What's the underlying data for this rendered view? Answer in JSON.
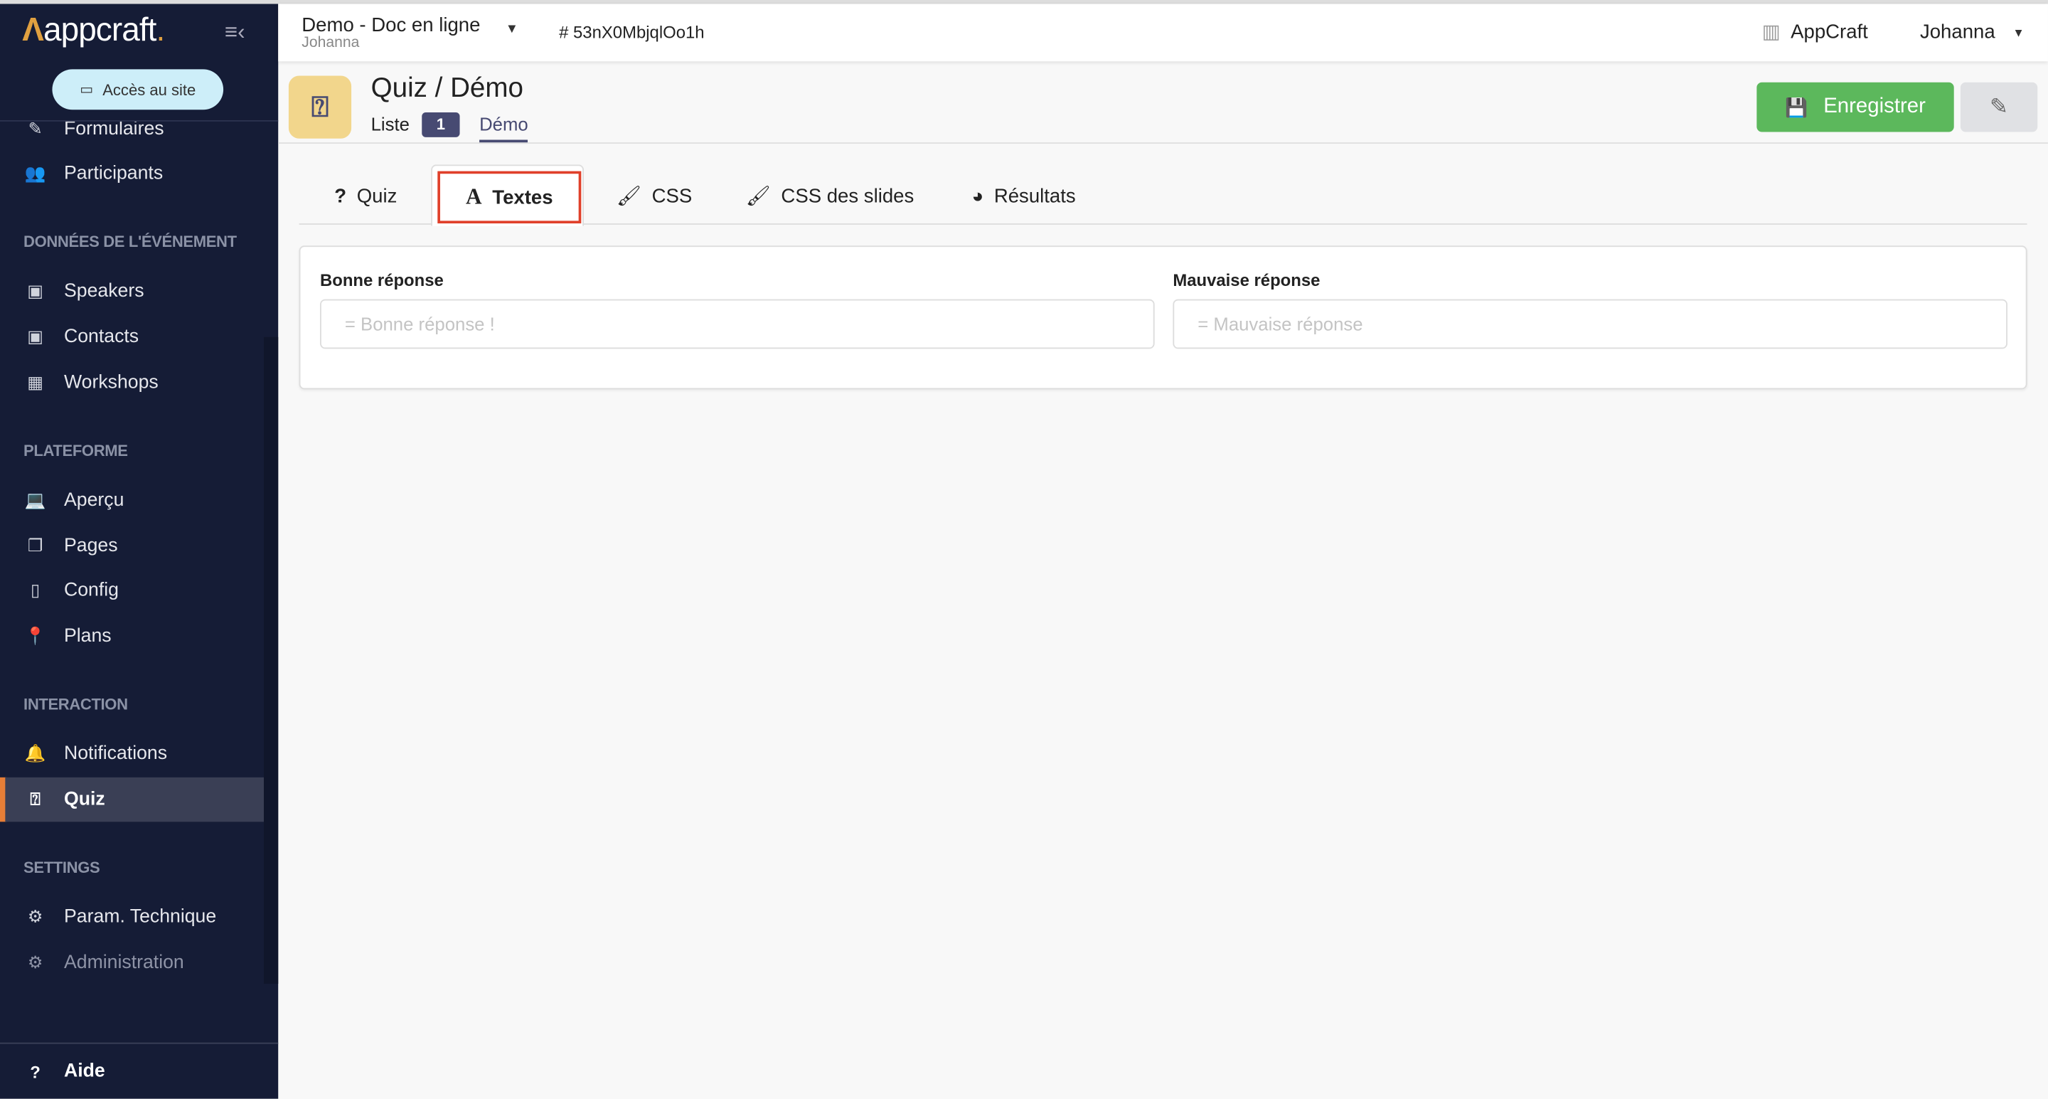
{
  "brand": {
    "logo_text": "appcraft",
    "colors": {
      "sidebar": "#151c36",
      "accent": "#e67e37",
      "save": "#5cb85c",
      "badge": "#474a72"
    }
  },
  "sidebar": {
    "site_button": "Accès au site",
    "partial_item": "Formulaires",
    "items_top": [
      {
        "label": "Participants",
        "icon": "users-icon"
      }
    ],
    "sections": [
      {
        "title": "DONNÉES DE L'ÉVÉNEMENT",
        "items": [
          {
            "label": "Speakers"
          },
          {
            "label": "Contacts"
          },
          {
            "label": "Workshops"
          }
        ]
      },
      {
        "title": "PLATEFORME",
        "items": [
          {
            "label": "Aperçu"
          },
          {
            "label": "Pages"
          },
          {
            "label": "Config"
          },
          {
            "label": "Plans"
          }
        ]
      },
      {
        "title": "INTERACTION",
        "items": [
          {
            "label": "Notifications"
          },
          {
            "label": "Quiz",
            "active": true
          }
        ]
      },
      {
        "title": "SETTINGS",
        "items": [
          {
            "label": "Param. Technique"
          },
          {
            "label": "Administration"
          }
        ]
      }
    ],
    "help": "Aide"
  },
  "header": {
    "project": "Demo - Doc en ligne",
    "owner": "Johanna",
    "id": "# 53nX0MbjqlOo1h",
    "org": "AppCraft",
    "user": "Johanna"
  },
  "page": {
    "title": "Quiz / Démo",
    "breadcrumb_list": "Liste",
    "list_count": "1",
    "breadcrumb_current": "Démo",
    "save_label": "Enregistrer"
  },
  "tabs": [
    {
      "label": "Quiz"
    },
    {
      "label": "Textes",
      "active": true
    },
    {
      "label": "CSS"
    },
    {
      "label": "CSS des slides"
    },
    {
      "label": "Résultats"
    }
  ],
  "form": {
    "good": {
      "label": "Bonne réponse",
      "placeholder": "= Bonne réponse !",
      "value": ""
    },
    "bad": {
      "label": "Mauvaise réponse",
      "placeholder": "= Mauvaise réponse",
      "value": ""
    }
  }
}
